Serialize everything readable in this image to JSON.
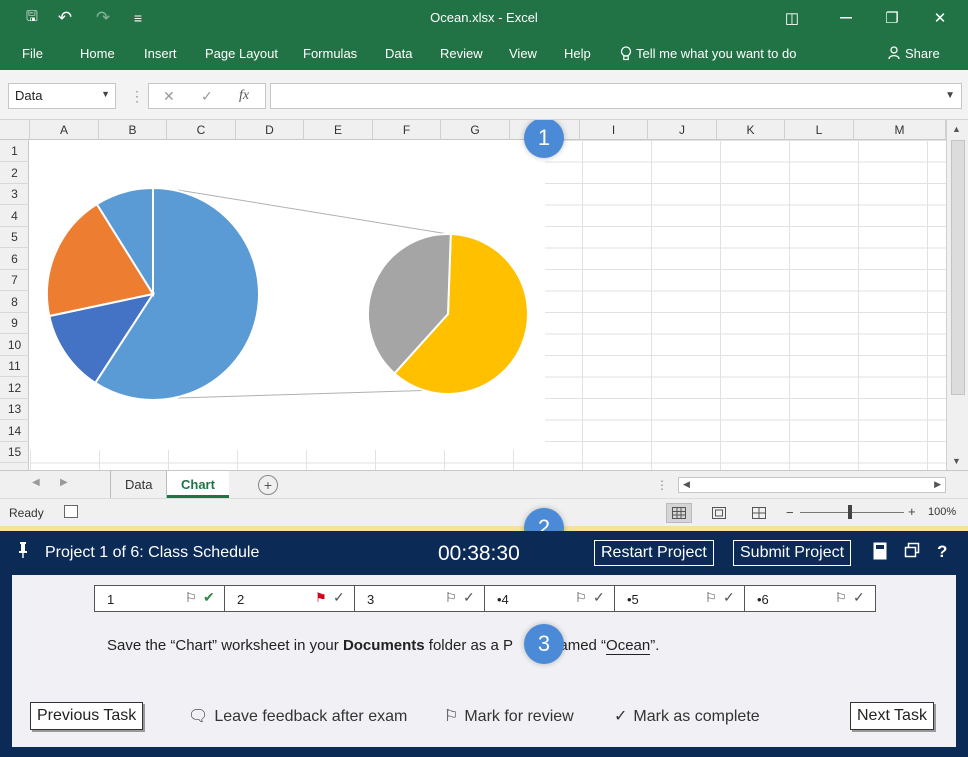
{
  "window": {
    "title": "Ocean.xlsx  -  Excel",
    "undo_glyph": "↶",
    "redo_glyph": "↷",
    "customize_glyph": "≡",
    "save_glyph": "🖫",
    "restore_ribbon_glyph": "◫",
    "restore_glyph": "❐",
    "close_glyph": "✕"
  },
  "ribbon": {
    "tabs": [
      "File",
      "Home",
      "Insert",
      "Page Layout",
      "Formulas",
      "Data",
      "Review",
      "View",
      "Help"
    ],
    "tell_me": "Tell me what you want to do",
    "share": "Share"
  },
  "formula_bar": {
    "name_box": "Data",
    "cancel_glyph": "✕",
    "enter_glyph": "✓",
    "fx_glyph": "fx",
    "formula": ""
  },
  "grid": {
    "columns": [
      "A",
      "B",
      "C",
      "D",
      "E",
      "F",
      "G",
      "H",
      "I",
      "J",
      "K",
      "L",
      "M"
    ],
    "rows": [
      "1",
      "2",
      "3",
      "4",
      "5",
      "6",
      "7",
      "8",
      "9",
      "10",
      "11",
      "12",
      "13",
      "14",
      "15"
    ]
  },
  "callouts": [
    "1",
    "2",
    "3"
  ],
  "chart": {
    "type": "pie-of-pie",
    "main_pie_colors": [
      "#5b9bd5",
      "#4472c4",
      "#ed7d31"
    ],
    "secondary_pie_colors": [
      "#ffc000",
      "#a5a5a5"
    ]
  },
  "sheet_tabs": {
    "tabs": [
      "Data",
      "Chart"
    ],
    "active": "Chart",
    "add_glyph": "+"
  },
  "status_bar": {
    "ready": "Ready",
    "zoom": "100%",
    "zoom_minus": "−",
    "zoom_plus": "+"
  },
  "exam": {
    "project_title": "Project 1 of 6: Class Schedule",
    "timer": "00:38:30",
    "restart_label": "Restart Project",
    "submit_label": "Submit Project",
    "help_glyph": "?",
    "tasks": [
      {
        "label": "1",
        "flag": "⚐",
        "check": "✔",
        "flag_color": "#333",
        "check_color": "#2e8b3c"
      },
      {
        "label": "2",
        "flag": "⚑",
        "check": "✓",
        "flag_color": "#d0021b",
        "check_color": "#555"
      },
      {
        "label": "3",
        "flag": "⚐",
        "check": "✓",
        "flag_color": "#333",
        "check_color": "#555"
      },
      {
        "label": "•4",
        "flag": "⚐",
        "check": "✓",
        "flag_color": "#333",
        "check_color": "#555"
      },
      {
        "label": "•5",
        "flag": "⚐",
        "check": "✓",
        "flag_color": "#333",
        "check_color": "#555"
      },
      {
        "label": "•6",
        "flag": "⚐",
        "check": "✓",
        "flag_color": "#333",
        "check_color": "#555"
      }
    ],
    "instruction": {
      "part1": "Save the “Chart” worksheet in your ",
      "bold": "Documents",
      "part2": " folder as a P",
      "part3": "named “",
      "file": "Ocean",
      "part4": "”."
    },
    "previous_label": "Previous Task",
    "feedback_label": "Leave feedback after exam",
    "review_label": "Mark for review",
    "complete_label": "Mark as complete",
    "next_label": "Next Task"
  },
  "colors": {
    "excel_green": "#217346",
    "exam_navy": "#0b2a55",
    "callout_blue": "#4a8ad6"
  }
}
